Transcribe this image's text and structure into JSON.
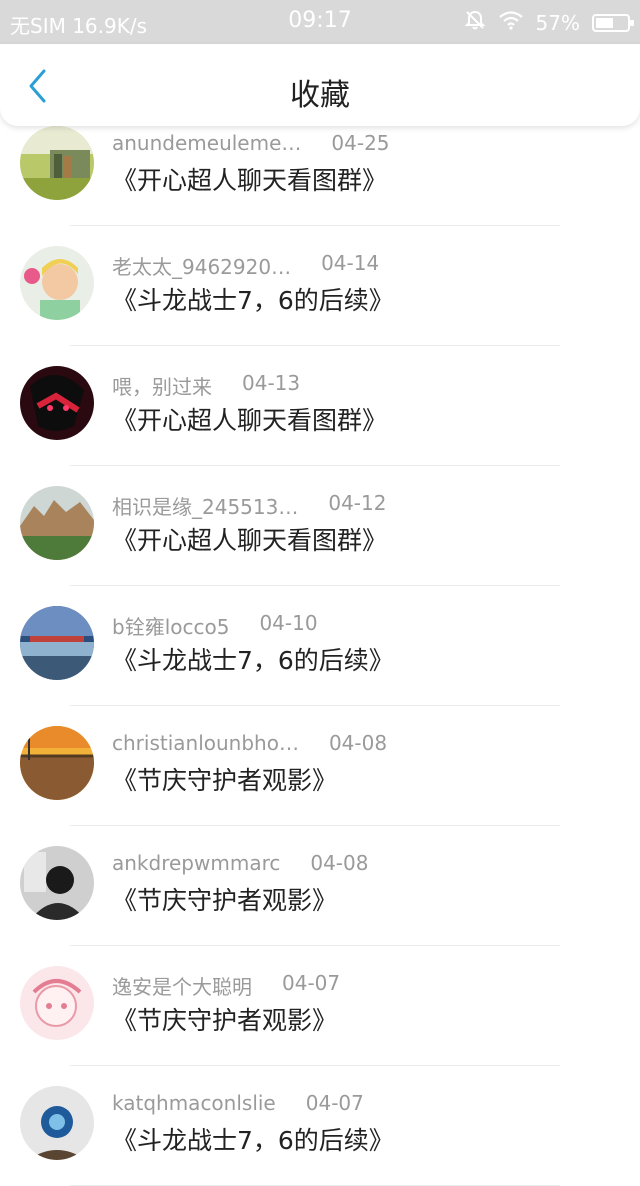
{
  "status_bar": {
    "carrier": "无SIM 16.9K/s",
    "time": "09:17",
    "battery": "57%",
    "battery_level": 0.57
  },
  "header": {
    "title": "收藏",
    "back_icon": "chevron-left-icon",
    "accent": "#2a9fd6"
  },
  "items": [
    {
      "user": "anundemeuleme…",
      "date": "04-25",
      "title": "《开心超人聊天看图群》"
    },
    {
      "user": "老太太_9462920…",
      "date": "04-14",
      "title": "《斗龙战士7，6的后续》"
    },
    {
      "user": "喂，别过来",
      "date": "04-13",
      "title": "《开心超人聊天看图群》"
    },
    {
      "user": "相识是缘_245513…",
      "date": "04-12",
      "title": "《开心超人聊天看图群》"
    },
    {
      "user": "b铨雍locco5",
      "date": "04-10",
      "title": "《斗龙战士7，6的后续》"
    },
    {
      "user": "christianlounbho…",
      "date": "04-08",
      "title": "《节庆守护者观影》"
    },
    {
      "user": "ankdrepwmmarc",
      "date": "04-08",
      "title": "《节庆守护者观影》"
    },
    {
      "user": "逸安是个大聪明",
      "date": "04-07",
      "title": "《节庆守护者观影》"
    },
    {
      "user": "katqhmaconlslie",
      "date": "04-07",
      "title": "《斗龙战士7，6的后续》"
    }
  ]
}
